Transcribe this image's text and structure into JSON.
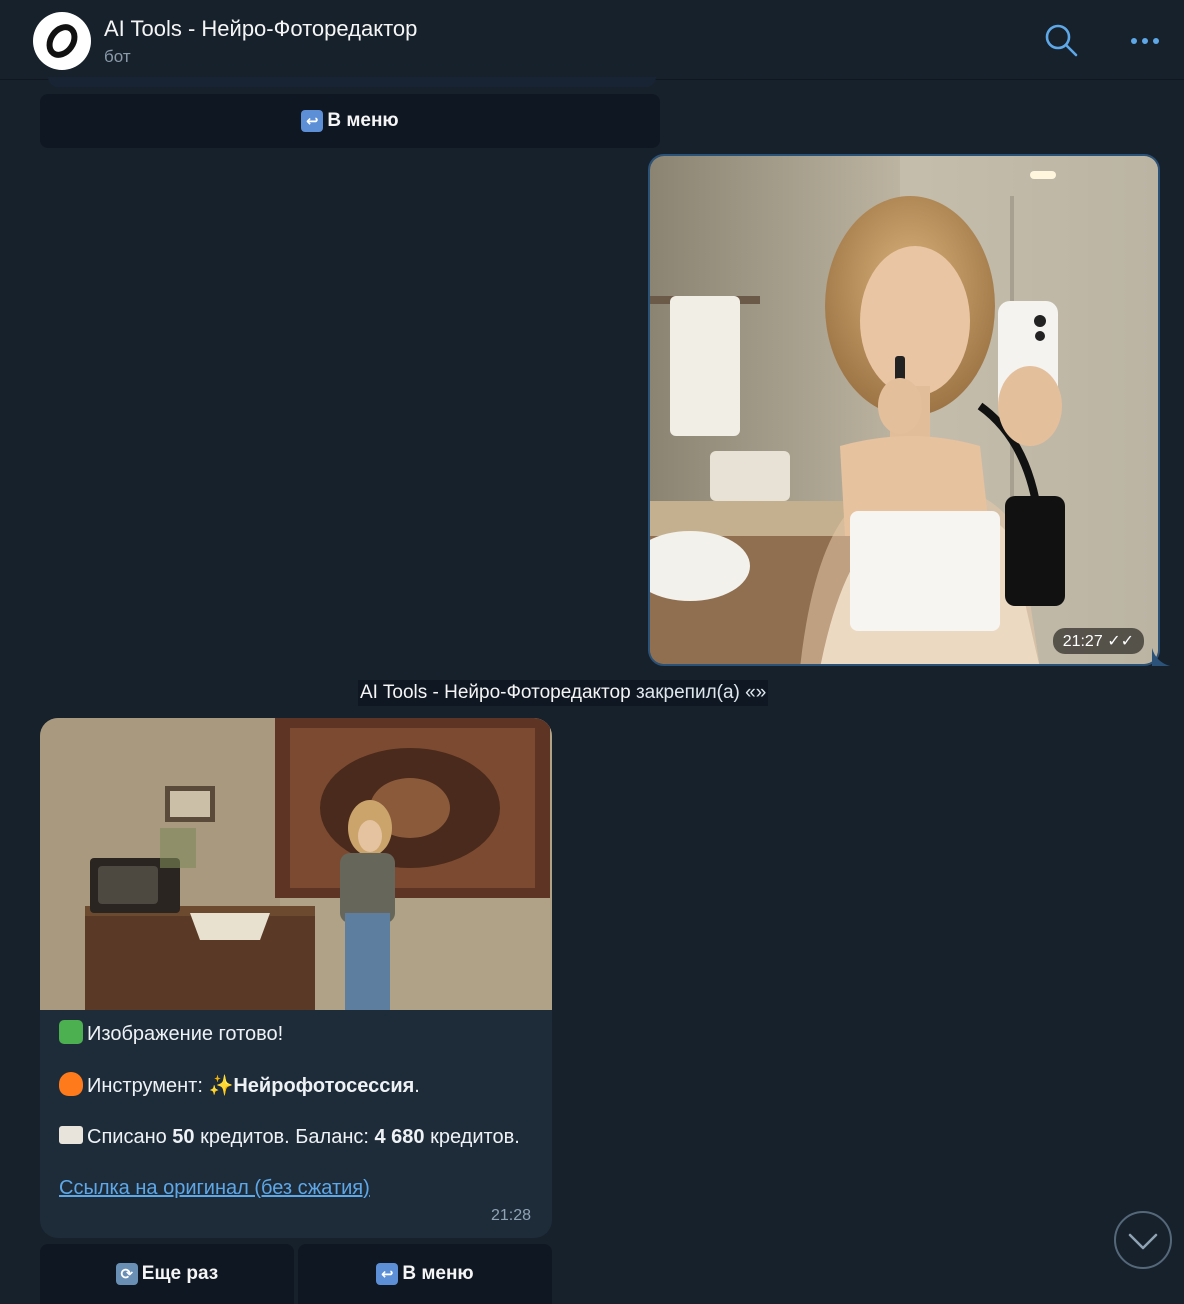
{
  "header": {
    "title": "AI Tools - Нейро-Фоторедактор",
    "subtitle": "бот",
    "avatar_letter": "0"
  },
  "top_button": {
    "label": "В меню",
    "icon": "return-arrow-icon"
  },
  "outgoing_photo": {
    "time": "21:27"
  },
  "service_message": {
    "actor": "AI Tools - Нейро-Фоторедактор",
    "text": " закрепил(а) «»"
  },
  "incoming_message": {
    "line1": "Изображение готово!",
    "line2_prefix": "Инструмент: ",
    "line2_tool": "Нейрофотосессия",
    "line2_suffix": ".",
    "line3_a": "Списано ",
    "line3_credits": "50",
    "line3_b": " кредитов. Баланс: ",
    "line3_balance": "4 680",
    "line3_c": " кредитов.",
    "link": "Ссылка на оригинал (без сжатия)",
    "time": "21:28"
  },
  "bottom_buttons": {
    "again": "Еще раз",
    "menu": "В меню"
  },
  "colors": {
    "background": "#17212b",
    "bubble_in": "#1e2c3a",
    "link": "#5ea8e8",
    "accent": "#5c8fd6"
  }
}
